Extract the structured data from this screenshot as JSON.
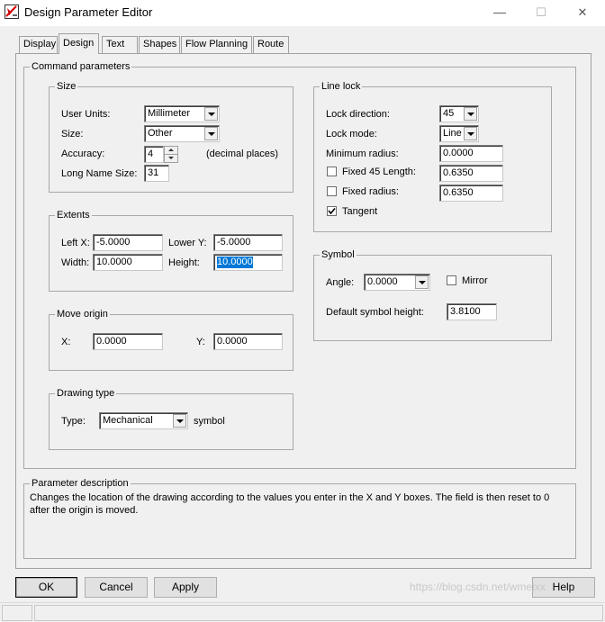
{
  "window": {
    "title": "Design Parameter Editor",
    "minimize": "—",
    "maximize": "☐",
    "close": "✕"
  },
  "tabs": [
    {
      "label": "Display"
    },
    {
      "label": "Design"
    },
    {
      "label": "Text"
    },
    {
      "label": "Shapes"
    },
    {
      "label": "Flow Planning"
    },
    {
      "label": "Route"
    }
  ],
  "command_parameters": {
    "title": "Command parameters",
    "size": {
      "title": "Size",
      "user_units_label": "User Units:",
      "user_units_value": "Millimeter",
      "size_label": "Size:",
      "size_value": "Other",
      "accuracy_label": "Accuracy:",
      "accuracy_value": "4",
      "accuracy_suffix": "(decimal places)",
      "long_name_label": "Long Name Size:",
      "long_name_value": "31"
    },
    "extents": {
      "title": "Extents",
      "left_x_label": "Left X:",
      "left_x_value": "-5.0000",
      "lower_y_label": "Lower Y:",
      "lower_y_value": "-5.0000",
      "width_label": "Width:",
      "width_value": "10.0000",
      "height_label": "Height:",
      "height_value": "10.0000"
    },
    "move_origin": {
      "title": "Move origin",
      "x_label": "X:",
      "x_value": "0.0000",
      "y_label": "Y:",
      "y_value": "0.0000"
    },
    "drawing_type": {
      "title": "Drawing type",
      "type_label": "Type:",
      "type_value": "Mechanical",
      "type_suffix": "symbol"
    },
    "line_lock": {
      "title": "Line lock",
      "lock_direction_label": "Lock direction:",
      "lock_direction_value": "45",
      "lock_mode_label": "Lock mode:",
      "lock_mode_value": "Line",
      "min_radius_label": "Minimum radius:",
      "min_radius_value": "0.0000",
      "fixed45_label": "Fixed 45 Length:",
      "fixed45_value": "0.6350",
      "fixed45_checked": false,
      "fixed_radius_label": "Fixed radius:",
      "fixed_radius_value": "0.6350",
      "fixed_radius_checked": false,
      "tangent_label": "Tangent",
      "tangent_checked": true
    },
    "symbol": {
      "title": "Symbol",
      "angle_label": "Angle:",
      "angle_value": "0.0000",
      "mirror_label": "Mirror",
      "mirror_checked": false,
      "default_height_label": "Default symbol height:",
      "default_height_value": "3.8100"
    }
  },
  "parameter_description": {
    "title": "Parameter description",
    "text": "Changes the location of the drawing according to the values you enter in the X and Y boxes. The field is then reset to 0 after the origin is moved."
  },
  "buttons": {
    "ok": "OK",
    "cancel": "Cancel",
    "apply": "Apply",
    "help": "Help"
  },
  "watermark": "https://blog.csdn.net/wmeixx",
  "colors": {
    "selection": "#0078d7",
    "panel": "#f0f0f0",
    "title_bar": "#ffffff"
  }
}
